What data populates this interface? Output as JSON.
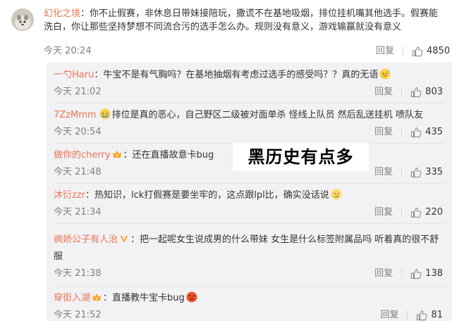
{
  "main_comment": {
    "username": "幻化之境",
    "text": "：你不止假赛，非休息日带妹接陪玩，撒谎不在基地吸烟，排位挂机嘴其他选手。假赛能洗白，你让那些坚持梦想不同流合污的选手怎么办。规则没有意义，游戏输赢就没有意义",
    "time": "今天 20:24",
    "reply_label": "回复",
    "likes": "4850"
  },
  "replies": [
    {
      "username": "一勺Haru",
      "text": "：牛宝不是有气胸吗？在基地抽烟有考虑过选手的感受吗？？真的无语",
      "emoji": "sweat",
      "time": "今天 21:02",
      "reply_label": "回复",
      "likes": "803"
    },
    {
      "username": "7ZzMmm",
      "text": "排位是真的恶心，自己野区二级被对面单杀 怪线上队员 然后乱送挂机 喷队友",
      "emoji_prefix": "crying",
      "time": "今天 20:54",
      "reply_label": "回复",
      "likes": "435"
    },
    {
      "username": "做你的cherry",
      "text": "：还在直播故意卡bug",
      "badge": "vip",
      "time": "今天 21:48",
      "reply_label": "回复",
      "likes": "335"
    },
    {
      "username": "沐衍zzr",
      "text": "：热知识，lck打假赛是要坐牢的，这点跟lpl比，确实没话说",
      "emoji": "smirk",
      "time": "今天 21:34",
      "reply_label": "回复",
      "likes": "220"
    },
    {
      "username": "病娇公子有人治",
      "text": "：把一起呢女生说成男的什么带妹 女生是什么标签附属品吗 听着真的很不舒服",
      "badge": "v",
      "time": "今天 21:38",
      "reply_label": "回复",
      "likes": "138"
    },
    {
      "username": "穿街入湖",
      "text": "：直播教牛宝卡bug",
      "emoji": "angry",
      "badge": "vip",
      "time": "今天 21:52",
      "reply_label": "回复",
      "likes": "81"
    }
  ],
  "overlay_caption": "黑历史有点多",
  "colors": {
    "username": "#eb7350",
    "reply_bg": "#f2f2f5",
    "meta": "#808080"
  }
}
